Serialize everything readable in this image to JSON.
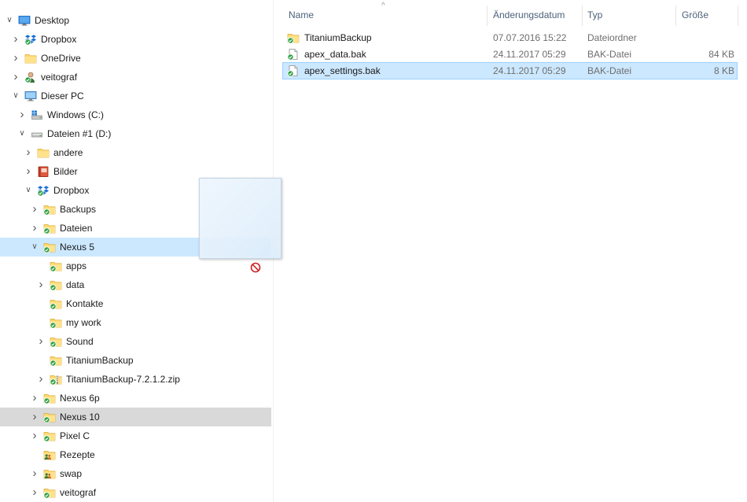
{
  "navigation": {
    "items": [
      {
        "label": "Desktop",
        "icon": "desktop-icon",
        "depth": 0,
        "expander": "expanded",
        "state": ""
      },
      {
        "label": "Dropbox",
        "icon": "dropbox-icon",
        "depth": 1,
        "expander": "collapsed",
        "state": ""
      },
      {
        "label": "OneDrive",
        "icon": "folder-icon",
        "depth": 1,
        "expander": "collapsed",
        "state": ""
      },
      {
        "label": "veitograf",
        "icon": "user-icon",
        "depth": 1,
        "expander": "collapsed",
        "state": ""
      },
      {
        "label": "Dieser PC",
        "icon": "pc-icon",
        "depth": 1,
        "expander": "expanded",
        "state": ""
      },
      {
        "label": "Windows (C:)",
        "icon": "windows-drive-icon",
        "depth": 2,
        "expander": "collapsed",
        "state": ""
      },
      {
        "label": "Dateien #1 (D:)",
        "icon": "drive-icon",
        "depth": 2,
        "expander": "expanded",
        "state": ""
      },
      {
        "label": "andere",
        "icon": "folder-icon",
        "depth": 3,
        "expander": "collapsed",
        "state": ""
      },
      {
        "label": "Bilder",
        "icon": "pictures-folder-icon",
        "depth": 3,
        "expander": "collapsed",
        "state": ""
      },
      {
        "label": "Dropbox",
        "icon": "dropbox-icon",
        "depth": 3,
        "expander": "expanded",
        "state": ""
      },
      {
        "label": "Backups",
        "icon": "synced-folder-icon",
        "depth": 4,
        "expander": "collapsed",
        "state": ""
      },
      {
        "label": "Dateien",
        "icon": "synced-folder-icon",
        "depth": 4,
        "expander": "collapsed",
        "state": ""
      },
      {
        "label": "Nexus 5",
        "icon": "synced-folder-icon",
        "depth": 4,
        "expander": "expanded",
        "state": "selected"
      },
      {
        "label": "apps",
        "icon": "synced-folder-icon",
        "depth": 5,
        "expander": "none",
        "state": ""
      },
      {
        "label": "data",
        "icon": "synced-folder-icon",
        "depth": 5,
        "expander": "collapsed",
        "state": ""
      },
      {
        "label": "Kontakte",
        "icon": "synced-folder-icon",
        "depth": 5,
        "expander": "none",
        "state": ""
      },
      {
        "label": "my work",
        "icon": "synced-folder-icon",
        "depth": 5,
        "expander": "none",
        "state": ""
      },
      {
        "label": "Sound",
        "icon": "synced-folder-icon",
        "depth": 5,
        "expander": "collapsed",
        "state": ""
      },
      {
        "label": "TitaniumBackup",
        "icon": "synced-folder-icon",
        "depth": 5,
        "expander": "none",
        "state": ""
      },
      {
        "label": "TitaniumBackup-7.2.1.2.zip",
        "icon": "synced-zip-icon",
        "depth": 5,
        "expander": "collapsed",
        "state": ""
      },
      {
        "label": "Nexus 6p",
        "icon": "synced-folder-icon",
        "depth": 4,
        "expander": "collapsed",
        "state": ""
      },
      {
        "label": "Nexus 10",
        "icon": "synced-folder-icon",
        "depth": 4,
        "expander": "collapsed",
        "state": "hovered"
      },
      {
        "label": "Pixel C",
        "icon": "synced-folder-icon",
        "depth": 4,
        "expander": "collapsed",
        "state": ""
      },
      {
        "label": "Rezepte",
        "icon": "shared-folder-icon",
        "depth": 4,
        "expander": "none",
        "state": ""
      },
      {
        "label": "swap",
        "icon": "shared-folder-icon",
        "depth": 4,
        "expander": "collapsed",
        "state": ""
      },
      {
        "label": "veitograf",
        "icon": "synced-folder-icon",
        "depth": 4,
        "expander": "collapsed",
        "state": ""
      }
    ]
  },
  "file_list": {
    "columns": {
      "name": "Name",
      "modified": "Änderungsdatum",
      "type": "Typ",
      "size": "Größe"
    },
    "sort_indicator": "^",
    "rows": [
      {
        "name": "TitaniumBackup",
        "modified": "07.07.2016 15:22",
        "type": "Dateiordner",
        "size": "",
        "icon": "synced-folder-icon",
        "state": ""
      },
      {
        "name": "apex_data.bak",
        "modified": "24.11.2017 05:29",
        "type": "BAK-Datei",
        "size": "84 KB",
        "icon": "synced-file-icon",
        "state": ""
      },
      {
        "name": "apex_settings.bak",
        "modified": "24.11.2017 05:29",
        "type": "BAK-Datei",
        "size": "8 KB",
        "icon": "synced-file-icon",
        "state": "selected"
      }
    ]
  },
  "drag": {
    "cursor_icon": "no-drop-icon"
  },
  "colors": {
    "selection": "#cce8ff",
    "hover": "#d9d9d9",
    "sync_check": "#2ea043",
    "folder": "#ffd86b"
  }
}
